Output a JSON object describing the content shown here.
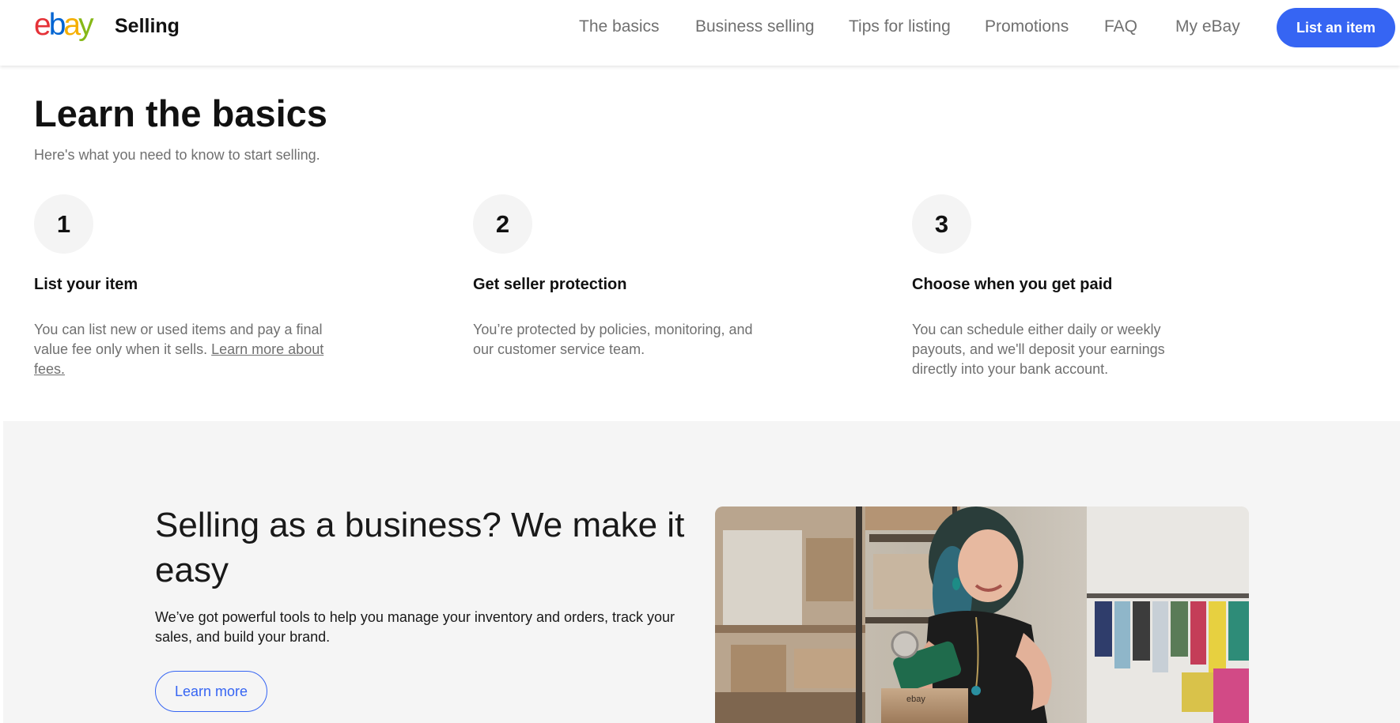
{
  "header": {
    "logo_letters": [
      "e",
      "b",
      "a",
      "y"
    ],
    "title": "Selling",
    "nav": [
      "The basics",
      "Business selling",
      "Tips for listing",
      "Promotions",
      "FAQ",
      "My eBay"
    ],
    "cta_label": "List an item"
  },
  "basics": {
    "heading": "Learn the basics",
    "subheading": "Here's what you need to know to start selling.",
    "steps": [
      {
        "number": "1",
        "title": "List your item",
        "desc_line1": "You can list new or used items and pay a final",
        "desc_line2_text": "value fee only when it sells. ",
        "desc_link_part1": "Learn more about",
        "desc_link_part2": "fees."
      },
      {
        "number": "2",
        "title": "Get seller protection",
        "desc_line1": "You’re protected by policies, monitoring, and",
        "desc_line2": "our customer service team."
      },
      {
        "number": "3",
        "title": "Choose when you get paid",
        "desc_line1": "You can schedule either daily or weekly",
        "desc_line2": "payouts, and we'll deposit your earnings",
        "desc_line3": "directly into your bank account."
      }
    ]
  },
  "business": {
    "title": "Selling as a business? We make it easy",
    "description": "We’ve got powerful tools to help you manage your inventory and orders, track your sales, and build your brand.",
    "button_label": "Learn more",
    "photo_box_label": "ebay"
  },
  "colors": {
    "accent": "#3665f3",
    "muted_text": "#707070",
    "section_bg": "#f5f5f5"
  }
}
